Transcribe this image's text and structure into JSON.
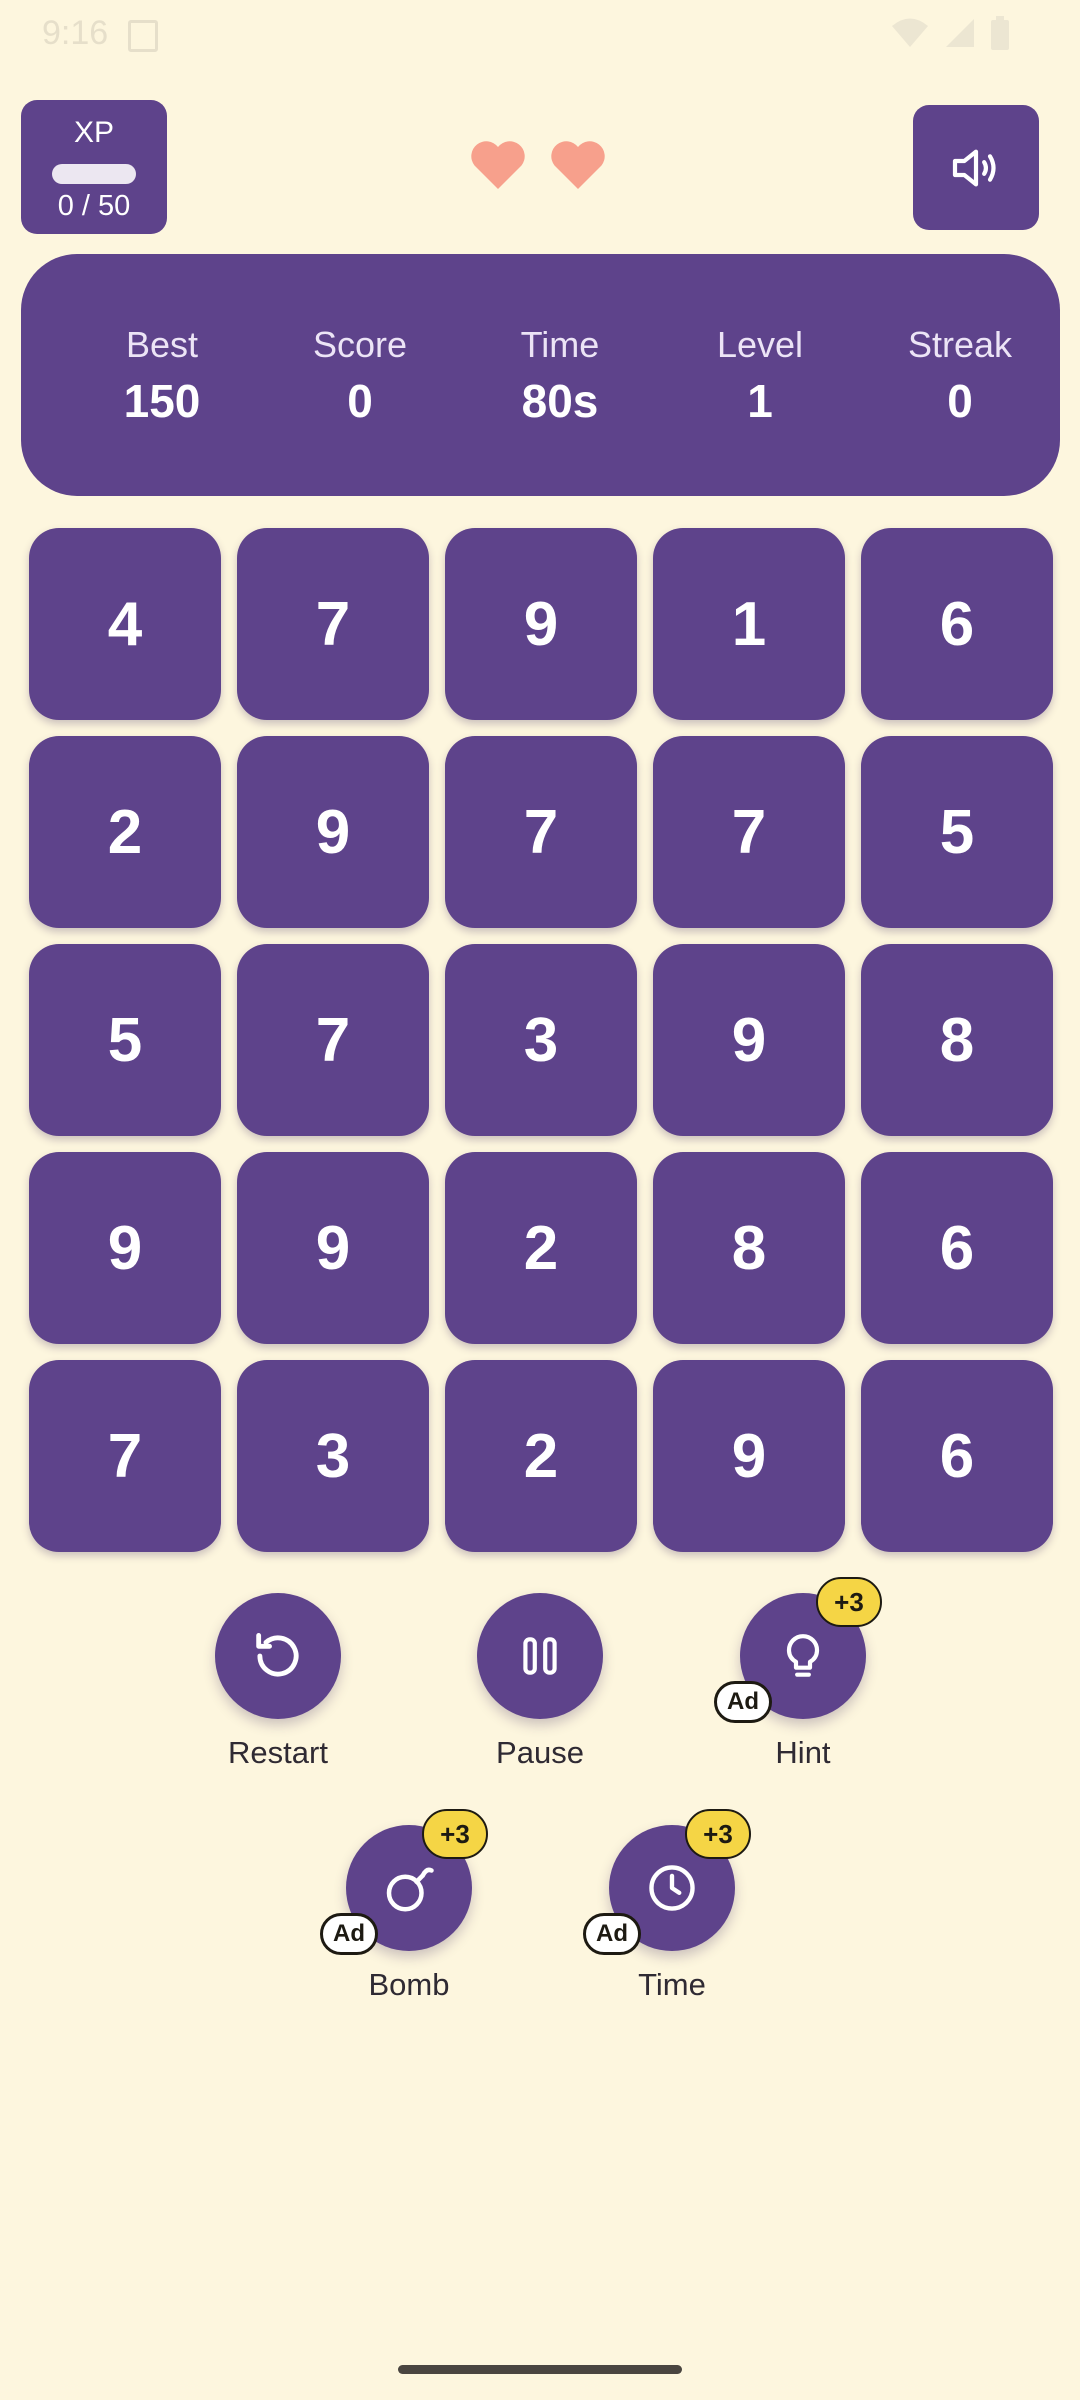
{
  "status_bar": {
    "time": "9:16",
    "icons": [
      "sim-card-icon",
      "wifi-icon",
      "signal-icon",
      "battery-icon"
    ]
  },
  "xp": {
    "label": "XP",
    "value": "0 / 50",
    "progress": 0
  },
  "lives": {
    "count": 2,
    "icon": "heart-icon",
    "color": "#f7a08c"
  },
  "sound_button": {
    "icon": "speaker-volume-icon"
  },
  "stats": [
    {
      "label": "Best",
      "value": "150"
    },
    {
      "label": "Score",
      "value": "0"
    },
    {
      "label": "Time",
      "value": "80s"
    },
    {
      "label": "Level",
      "value": "1"
    },
    {
      "label": "Streak",
      "value": "0"
    }
  ],
  "grid": [
    [
      "4",
      "7",
      "9",
      "1",
      "6"
    ],
    [
      "2",
      "9",
      "7",
      "7",
      "5"
    ],
    [
      "5",
      "7",
      "3",
      "9",
      "8"
    ],
    [
      "9",
      "9",
      "2",
      "8",
      "6"
    ],
    [
      "7",
      "3",
      "2",
      "9",
      "6"
    ]
  ],
  "actions": {
    "restart": {
      "label": "Restart",
      "icon": "restart-icon"
    },
    "pause": {
      "label": "Pause",
      "icon": "pause-icon"
    },
    "hint": {
      "label": "Hint",
      "icon": "lightbulb-icon",
      "badge": "+3",
      "ad": "Ad"
    },
    "bomb": {
      "label": "Bomb",
      "icon": "bomb-icon",
      "badge": "+3",
      "ad": "Ad"
    },
    "time": {
      "label": "Time",
      "icon": "clock-icon",
      "badge": "+3",
      "ad": "Ad"
    }
  },
  "colors": {
    "background": "#fdf6de",
    "primary": "#5e438b",
    "badge": "#f5d545",
    "heart": "#f7a08c"
  }
}
